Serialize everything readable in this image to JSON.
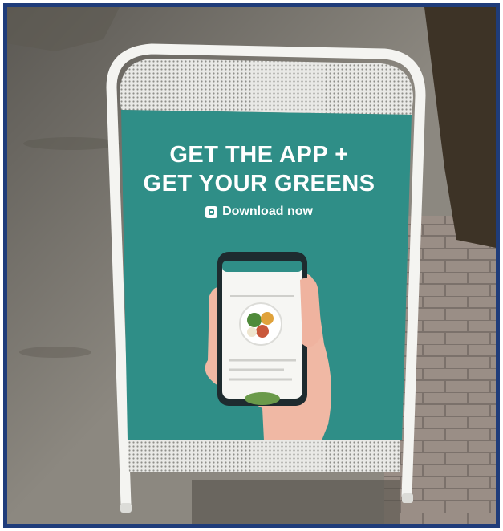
{
  "sign": {
    "headline_line1": "GET THE APP +",
    "headline_line2": "GET YOUR GREENS",
    "cta_label": "Download now",
    "cta_icon": "app-icon"
  },
  "colors": {
    "frame_border": "#1f3c7a",
    "poster_teal": "#2f8e87",
    "sign_frame": "#f2f2ef",
    "sidewalk": "#8d8a82",
    "brick": "#9a8e86"
  }
}
